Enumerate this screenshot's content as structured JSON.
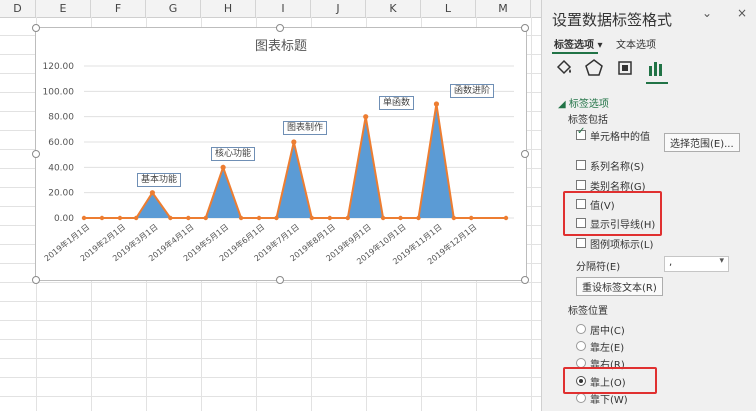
{
  "sheet": {
    "columns": [
      "D",
      "E",
      "F",
      "G",
      "H",
      "I",
      "J",
      "K",
      "L",
      "M"
    ]
  },
  "chart": {
    "title": "图表标题",
    "data_labels": [
      "基本功能",
      "核心功能",
      "图表制作",
      "单函数",
      "函数进阶"
    ]
  },
  "chart_data": {
    "type": "area",
    "title": "图表标题",
    "x_tick_labels": [
      "2019年1月1日",
      "2019年2月1日",
      "2019年3月1日",
      "2019年4月1日",
      "2019年5月1日",
      "2019年6月1日",
      "2019年7月1日",
      "2019年8月1日",
      "2019年9月1日",
      "2019年10月1日",
      "2019年11月1日",
      "2019年12月1日"
    ],
    "y_tick_labels": [
      "0.00",
      "20.00",
      "40.00",
      "60.00",
      "80.00",
      "100.00",
      "120.00"
    ],
    "ylim": [
      0,
      120
    ],
    "peaks": [
      {
        "x": "2019年3月1日",
        "y": 20,
        "label": "基本功能"
      },
      {
        "x": "2019年5月1日",
        "y": 40,
        "label": "核心功能"
      },
      {
        "x": "2019年7月1日",
        "y": 60,
        "label": "图表制作"
      },
      {
        "x": "2019年9月1日",
        "y": 80,
        "label": "单函数"
      },
      {
        "x": "2019年11月1日",
        "y": 90,
        "label": "函数进阶"
      }
    ],
    "fill_color": "#5b9bd5",
    "line_color": "#ed7d31",
    "grid": true
  },
  "pane": {
    "title": "设置数据标签格式",
    "close": "×",
    "tabs": [
      "标签选项",
      "文本选项"
    ],
    "section": "标签选项",
    "include_label": "标签包括",
    "checkboxes": [
      {
        "label": "单元格中的值",
        "checked": true
      },
      {
        "label": "系列名称(S)",
        "checked": false
      },
      {
        "label": "类别名称(G)",
        "checked": false
      },
      {
        "label": "值(V)",
        "checked": false
      },
      {
        "label": "显示引导线(H)",
        "checked": false
      },
      {
        "label": "图例项标示(L)",
        "checked": false
      }
    ],
    "select_range": "选择范围(E)...",
    "separator_label": "分隔符(E)",
    "separator_value": ",",
    "reset_button": "重设标签文本(R)",
    "position_label": "标签位置",
    "positions": [
      {
        "label": "居中(C)",
        "selected": false
      },
      {
        "label": "靠左(E)",
        "selected": false
      },
      {
        "label": "靠右(R)",
        "selected": false
      },
      {
        "label": "靠上(O)",
        "selected": true
      },
      {
        "label": "靠下(W)",
        "selected": false
      }
    ],
    "highlight_color": "#e03030",
    "accent_color": "#217346"
  }
}
